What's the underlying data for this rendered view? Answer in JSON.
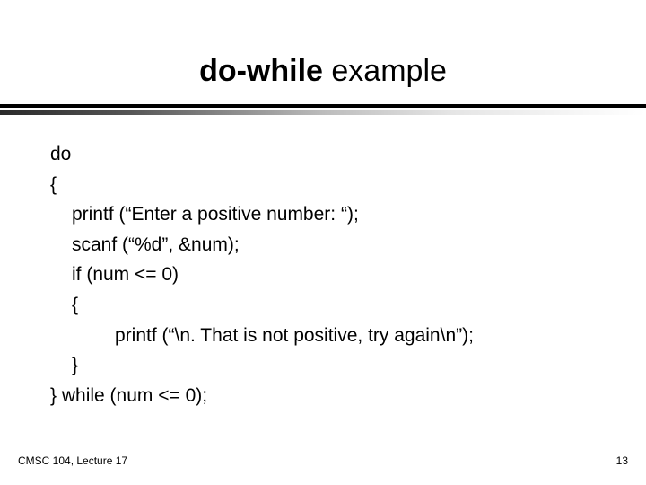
{
  "title": {
    "bold": "do-while",
    "rest": " example"
  },
  "code": {
    "l0": "do",
    "l1": "{",
    "l2": "printf (“Enter a positive number: “);",
    "l3": "scanf (“%d”, &num);",
    "l4": "if (num <= 0)",
    "l5": "{",
    "l6": "printf (“\\n. That is not positive, try again\\n”);",
    "l7": "}",
    "l8": "} while (num <= 0);"
  },
  "footer": {
    "left": "CMSC 104, Lecture 17",
    "right": "13"
  }
}
